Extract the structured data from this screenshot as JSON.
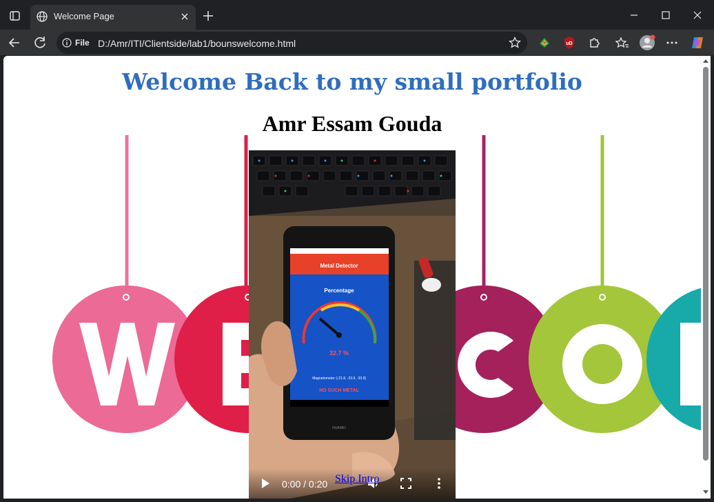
{
  "browser": {
    "tab": {
      "title": "Welcome Page",
      "favicon": "globe-icon"
    },
    "address": {
      "scheme": "File",
      "url": "D:/Amr/ITI/Clientside/lab1/bounswelcome.html"
    }
  },
  "page": {
    "heading": "Welcome Back to my small portfolio",
    "name": "Amr Essam Gouda",
    "video": {
      "time": "0:00 / 0:20",
      "screen_title": "Metal Detector",
      "screen_label": "Percentage",
      "screen_value": "32.7 %",
      "screen_readout": "Magnetometer: [-21.8, -23.9, -33.9]",
      "screen_status": "NO SUCH METAL",
      "brand": "HUAWEI"
    },
    "skip_link": "Skip Intro"
  },
  "colors": {
    "heading": "#2f6dbf",
    "link": "#0000ee",
    "tab_bg": "#323335",
    "frame_bg": "#202124"
  }
}
